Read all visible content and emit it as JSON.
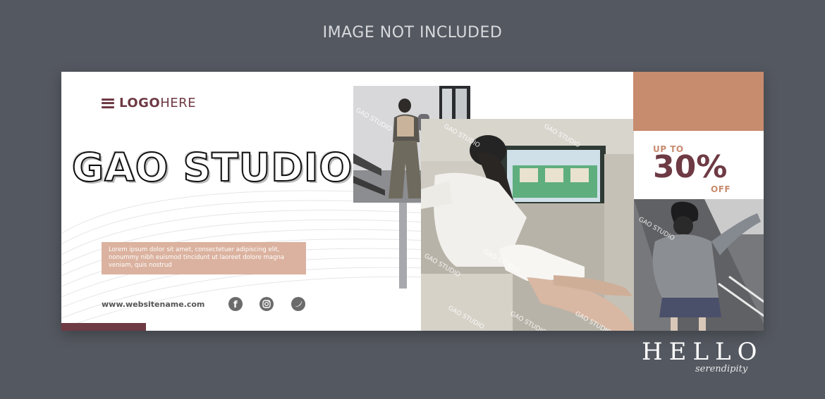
{
  "header": {
    "notice": "IMAGE NOT INCLUDED"
  },
  "banner": {
    "logo": {
      "bold": "LOGO",
      "light": "HERE",
      "icon": "hamburger-menu-icon"
    },
    "title": "GAO STUDIO",
    "body_text": "Lorem ipsum dolor sit amet, consectetuer adipiscing elit, nonummy nibh euismod tincidunt ut laoreet dolore magna veniam, quis nostrud",
    "website": "www.websitename.com",
    "social": [
      {
        "name": "facebook-icon",
        "glyph": "f"
      },
      {
        "name": "instagram-icon",
        "glyph": "◎"
      },
      {
        "name": "twitter-icon",
        "glyph": "t"
      }
    ],
    "promo": {
      "up_to": "UP TO",
      "percent": "30%",
      "off": "OFF"
    },
    "photo_watermark": "GAO STUDIO",
    "colors": {
      "maroon": "#6e3a44",
      "tan": "#c78b6e",
      "peach": "#dbb29f",
      "background": "#545860"
    }
  },
  "watermark": {
    "main": "HELLO",
    "script": "serendipity"
  }
}
